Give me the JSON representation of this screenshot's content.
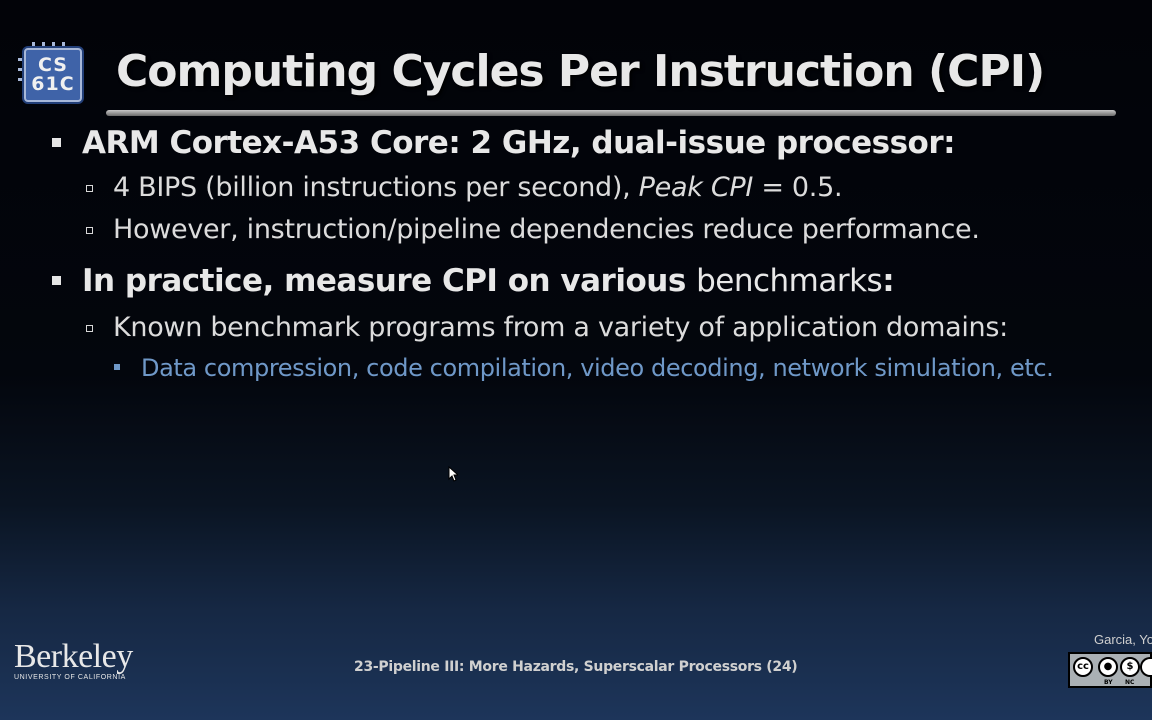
{
  "logo": {
    "line1": "CS",
    "line2": "61C"
  },
  "slide": {
    "title": "Computing Cycles Per Instruction (CPI)",
    "bullets": [
      {
        "text": "ARM Cortex-A53 Core: 2 GHz, dual-issue processor:",
        "subs": [
          {
            "pre": "4 BIPS (billion instructions per second), ",
            "em": "Peak CPI",
            "post": " = 0.5."
          },
          {
            "text": "However, instruction/pipeline dependencies reduce performance."
          }
        ]
      },
      {
        "bold": "In practice, measure CPI on various ",
        "light": "benchmarks",
        "colon": ":",
        "subs": [
          {
            "text": "Known benchmark programs from a variety of application domains:"
          }
        ],
        "subsubs": [
          {
            "text": "Data compression, code compilation, video decoding, network simulation, etc."
          }
        ]
      }
    ]
  },
  "footer": {
    "university": "Berkeley",
    "university_sub": "UNIVERSITY OF CALIFORNIA",
    "lecture": "23-Pipeline III: More Hazards, Superscalar Processors (24)",
    "author": "Garcia, Yo",
    "license": {
      "symbols": [
        "cc",
        "by",
        "nc",
        "sa"
      ],
      "labels": [
        "BY",
        "NC"
      ]
    }
  },
  "colors": {
    "sub_sub_bullet": "#6f98c8",
    "logo_fill": "#3f63a8"
  }
}
